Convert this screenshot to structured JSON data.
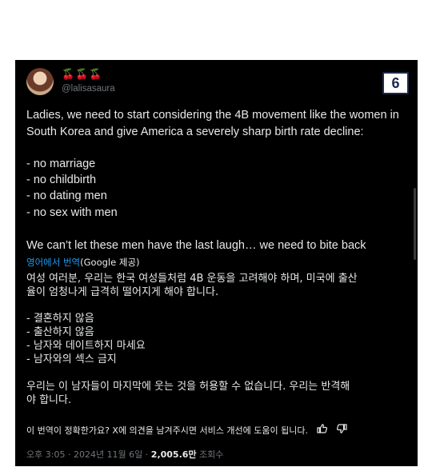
{
  "badge": "6",
  "author": {
    "emoji": "🍒🍒🍒",
    "handle": "@lalisasaura"
  },
  "post": {
    "en_line1": "Ladies, we need to start considering the 4B movement like the women in",
    "en_line2": "South Korea and give America a severely sharp birth rate decline:",
    "list": [
      "- no marriage",
      "- no childbirth",
      "- no dating men",
      "- no sex with men"
    ],
    "en_closing": "We can’t let these men have the last laugh… we need to bite back"
  },
  "translation": {
    "link_label": "영어에서 번역",
    "provider_open": "(",
    "provider": "Google",
    "provider_close": " 제공)",
    "ko_line1": "여성 여러분, 우리는 한국 여성들처럼 4B 운동을 고려해야 하며, 미국에 출산",
    "ko_line2": "율이 엄청나게 급격히 떨어지게 해야 합니다.",
    "ko_list": [
      "- 결혼하지 않음",
      "- 출산하지 않음",
      "- 남자와 데이트하지 마세요",
      "- 남자와의 섹스 금지"
    ],
    "ko_closing1": "우리는 이 남자들이 마지막에 웃는 것을 허용할 수 없습니다. 우리는 반격해",
    "ko_closing2": "야 합니다."
  },
  "feedback": {
    "text": "이 번역이 정확한가요? X에 의견을 남겨주시면 서비스 개선에 도움이 됩니다.",
    "thumb_up_icon": "thumbs-up-icon",
    "thumb_down_icon": "thumbs-down-icon"
  },
  "meta": {
    "time": "오후 3:05",
    "sep1": " · ",
    "date": "2024년 11월 6일",
    "sep2": " · ",
    "views": "2,005.6만",
    "views_label": " 조회수"
  }
}
